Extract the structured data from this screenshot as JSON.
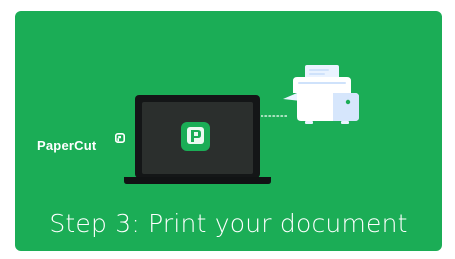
{
  "brand": {
    "name": "PaperCut",
    "accent": "#1bad56",
    "logo_icon": "papercut-p-mark-icon"
  },
  "illustration": {
    "laptop_icon": "laptop-icon",
    "app_icon": "papercut-app-icon",
    "printer_icon": "printer-icon",
    "connection_icon": "dotted-connection-icon"
  },
  "caption": {
    "text": "Step 3: Print your document"
  },
  "colors": {
    "background_green": "#1bad56",
    "laptop_screen": "#2b2f2d",
    "laptop_bezel": "#141617",
    "app_icon_green": "#1bad56",
    "printer_light": "#eaf3ff",
    "printer_mid": "#cfe2fb"
  }
}
